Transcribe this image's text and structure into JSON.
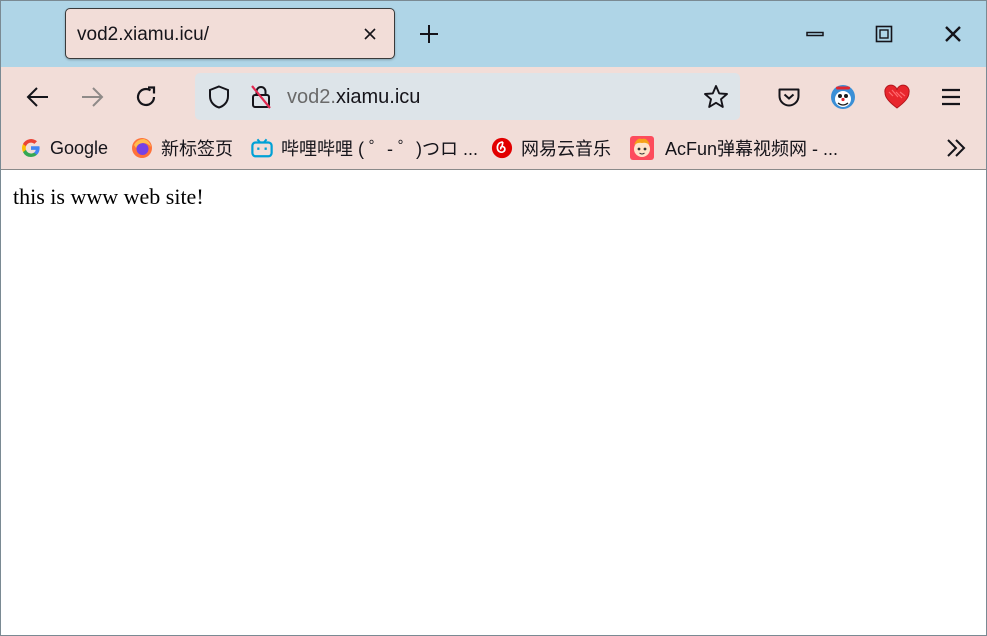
{
  "tab": {
    "title": "vod2.xiamu.icu/"
  },
  "urlbar": {
    "host_prefix": "vod2.",
    "host_main": "xiamu.icu"
  },
  "bookmarks": [
    {
      "label": "Google",
      "icon": "google-icon"
    },
    {
      "label": "新标签页",
      "icon": "firefox-icon"
    },
    {
      "label": "哔哩哔哩 ( ゜- ゜)つロ ...",
      "icon": "bilibili-icon"
    },
    {
      "label": "网易云音乐",
      "icon": "netease-music-icon"
    },
    {
      "label": "AcFun弹幕视频网 - ...",
      "icon": "acfun-icon"
    }
  ],
  "page": {
    "body_text": "this is www web site!"
  },
  "colors": {
    "titlebar": "#afd5e7",
    "toolbar": "#f2ddd8",
    "urlbar": "#dde4e9",
    "heart": "#e8262d"
  }
}
